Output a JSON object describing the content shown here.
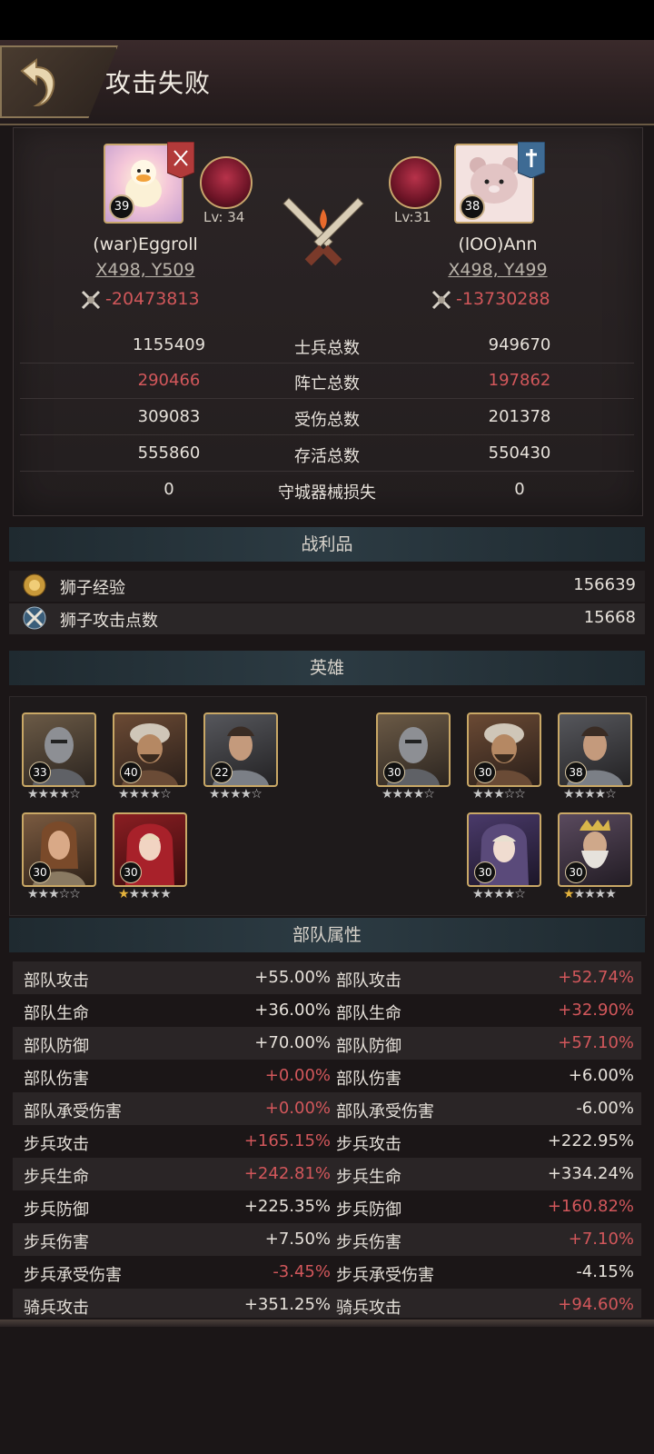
{
  "header": {
    "title": "攻击失败"
  },
  "attacker": {
    "name": "(war)Eggroll",
    "coords": "X498, Y509",
    "power_loss": "-20473813",
    "avatar_level": "39",
    "lion_level": "Lv: 34",
    "flag_color": "#b23a3a"
  },
  "defender": {
    "name": "(lOO)Ann",
    "coords": "X498, Y499",
    "power_loss": "-13730288",
    "avatar_level": "38",
    "lion_level": "Lv:31",
    "flag_color": "#3e6b94"
  },
  "stats": [
    {
      "label": "士兵总数",
      "left": "1155409",
      "right": "949670",
      "highlight": false
    },
    {
      "label": "阵亡总数",
      "left": "290466",
      "right": "197862",
      "highlight": true
    },
    {
      "label": "受伤总数",
      "left": "309083",
      "right": "201378",
      "highlight": false
    },
    {
      "label": "存活总数",
      "left": "555860",
      "right": "550430",
      "highlight": false
    },
    {
      "label": "守城器械损失",
      "left": "0",
      "right": "0",
      "highlight": false
    }
  ],
  "loot": {
    "title": "战利品",
    "items": [
      {
        "label": "狮子经验",
        "value": "156639",
        "icon": "lion-exp-icon"
      },
      {
        "label": "狮子攻击点数",
        "value": "15668",
        "icon": "lion-attack-points-icon"
      }
    ]
  },
  "heroes": {
    "title": "英雄",
    "left": [
      {
        "level": "33",
        "stars": 4,
        "gold": 0,
        "type": "knight"
      },
      {
        "level": "40",
        "stars": 4,
        "gold": 0,
        "type": "warlord"
      },
      {
        "level": "22",
        "stars": 4,
        "gold": 0,
        "type": "swordsman"
      },
      {
        "level": "30",
        "stars": 3,
        "gold": 0,
        "type": "warrior-woman"
      },
      {
        "level": "30",
        "stars": 5,
        "gold": 1,
        "type": "red-hood"
      }
    ],
    "right": [
      {
        "level": "30",
        "stars": 4,
        "gold": 0,
        "type": "knight"
      },
      {
        "level": "30",
        "stars": 3,
        "gold": 0,
        "type": "warlord"
      },
      {
        "level": "38",
        "stars": 4,
        "gold": 0,
        "type": "swordsman"
      },
      {
        "level": "30",
        "stars": 4,
        "gold": 0,
        "type": "hooded-mage"
      },
      {
        "level": "30",
        "stars": 5,
        "gold": 1,
        "type": "old-king"
      }
    ]
  },
  "troops": {
    "title": "部队属性",
    "rows": [
      {
        "label": "部队攻击",
        "left": "+55.00%",
        "left_red": false,
        "right": "+52.74%",
        "right_red": true
      },
      {
        "label": "部队生命",
        "left": "+36.00%",
        "left_red": false,
        "right": "+32.90%",
        "right_red": true
      },
      {
        "label": "部队防御",
        "left": "+70.00%",
        "left_red": false,
        "right": "+57.10%",
        "right_red": true
      },
      {
        "label": "部队伤害",
        "left": "+0.00%",
        "left_red": true,
        "right": "+6.00%",
        "right_red": false
      },
      {
        "label": "部队承受伤害",
        "left": "+0.00%",
        "left_red": true,
        "right": "-6.00%",
        "right_red": false
      },
      {
        "label": "步兵攻击",
        "left": "+165.15%",
        "left_red": true,
        "right": "+222.95%",
        "right_red": false
      },
      {
        "label": "步兵生命",
        "left": "+242.81%",
        "left_red": true,
        "right": "+334.24%",
        "right_red": false
      },
      {
        "label": "步兵防御",
        "left": "+225.35%",
        "left_red": false,
        "right": "+160.82%",
        "right_red": true
      },
      {
        "label": "步兵伤害",
        "left": "+7.50%",
        "left_red": false,
        "right": "+7.10%",
        "right_red": true
      },
      {
        "label": "步兵承受伤害",
        "left": "-3.45%",
        "left_red": true,
        "right": "-4.15%",
        "right_red": false
      },
      {
        "label": "骑兵攻击",
        "left": "+351.25%",
        "left_red": false,
        "right": "+94.60%",
        "right_red": true
      }
    ]
  }
}
